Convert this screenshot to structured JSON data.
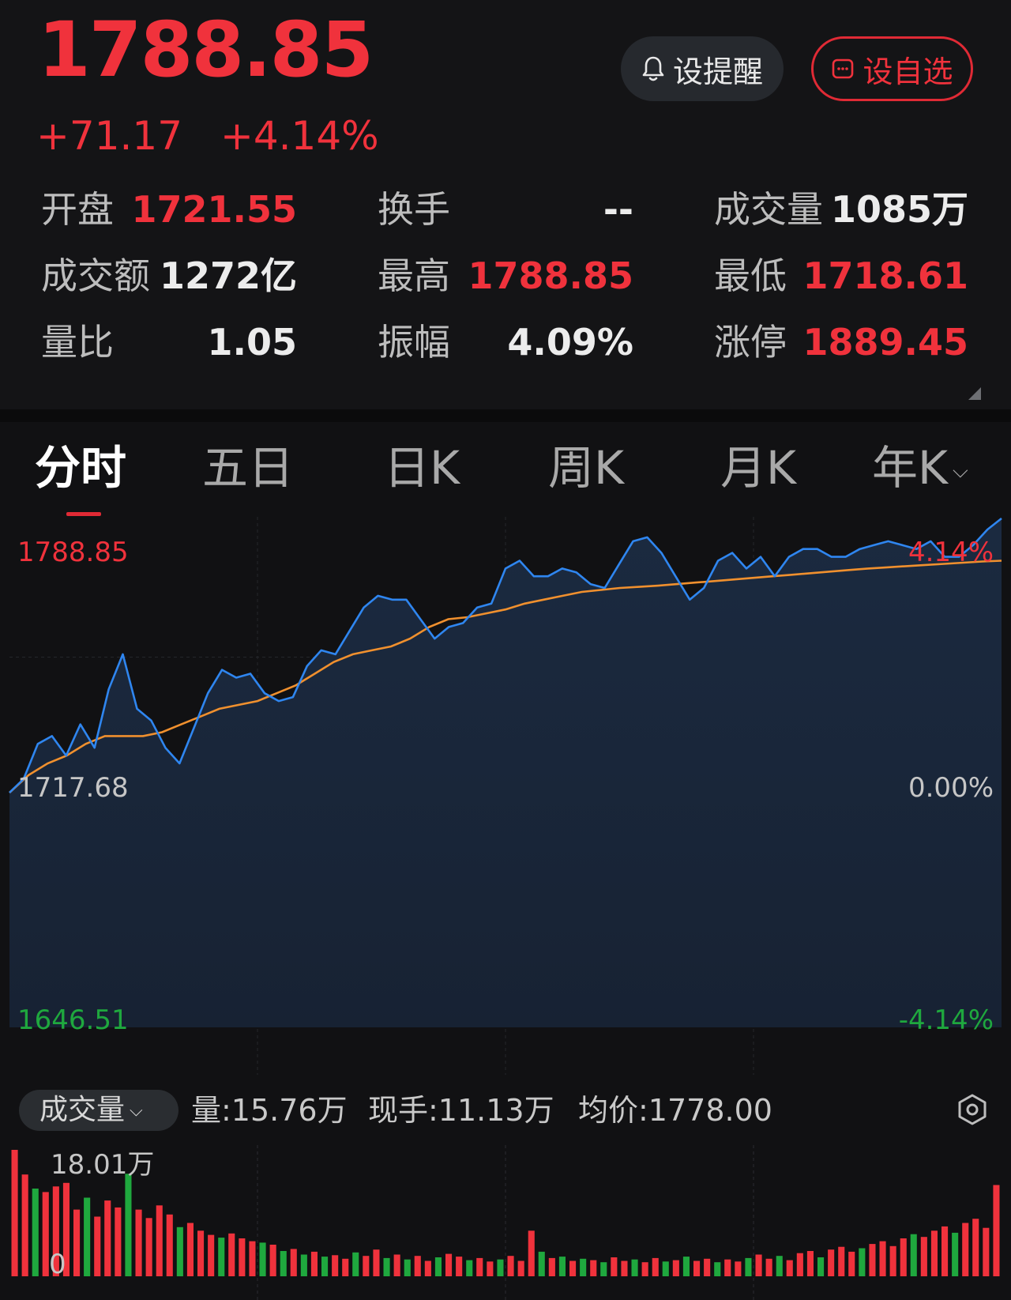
{
  "quote": {
    "price": "1788.85",
    "change": "+71.17",
    "change_pct": "+4.14%"
  },
  "buttons": {
    "alert_label": "设提醒",
    "watchlist_label": "设自选"
  },
  "stats": [
    {
      "label": "开盘",
      "value": "1721.55",
      "color": "red"
    },
    {
      "label": "换手",
      "value": "--",
      "color": "white"
    },
    {
      "label": "成交量",
      "value": "1085万",
      "color": "white"
    },
    {
      "label": "成交额",
      "value": "1272亿",
      "color": "white"
    },
    {
      "label": "最高",
      "value": "1788.85",
      "color": "red"
    },
    {
      "label": "最低",
      "value": "1718.61",
      "color": "red"
    },
    {
      "label": "量比",
      "value": "1.05",
      "color": "white"
    },
    {
      "label": "振幅",
      "value": "4.09%",
      "color": "white"
    },
    {
      "label": "涨停",
      "value": "1889.45",
      "color": "red"
    }
  ],
  "tabs": [
    "分时",
    "五日",
    "日K",
    "周K",
    "月K",
    "年K"
  ],
  "active_tab": "分时",
  "volume_bar": {
    "selector": "成交量",
    "vol_label": "量:15.76万",
    "now_label": "现手:11.13万",
    "avg_label": "均价:1778.00"
  },
  "colors": {
    "up": "#f0323c",
    "down": "#1fa83e",
    "price_line": "#2f86f0",
    "avg_line": "#f0902e",
    "background": "#111113"
  },
  "chart_data": {
    "type": "line",
    "title": "",
    "prev_close": 1717.68,
    "ylim": [
      1646.51,
      1788.85
    ],
    "y_labels_left": [
      "1788.85",
      "1717.68",
      "1646.51"
    ],
    "y_labels_right": [
      "4.14%",
      "0.00%",
      "-4.14%"
    ],
    "series": [
      {
        "values": [
          1718.5,
          1722,
          1731,
          1733,
          1728,
          1736,
          1730,
          1745,
          1754,
          1740,
          1737,
          1730,
          1726,
          1735,
          1744,
          1750,
          1748,
          1749,
          1744,
          1742,
          1743,
          1751,
          1755,
          1754,
          1760,
          1766,
          1769,
          1768,
          1768,
          1763,
          1758,
          1761,
          1762,
          1766,
          1767,
          1776,
          1778,
          1774,
          1774,
          1776,
          1775,
          1772,
          1771,
          1777,
          1783,
          1784,
          1780,
          1774,
          1768,
          1771,
          1778,
          1780,
          1776,
          1779,
          1774,
          1779,
          1781,
          1781,
          1779,
          1779,
          1781,
          1782,
          1783,
          1782,
          1781,
          1783,
          1779,
          1779,
          1782,
          1786,
          1788.85
        ]
      },
      {
        "values": [
          1718.5,
          1723,
          1726,
          1728,
          1731,
          1733,
          1733,
          1733,
          1734,
          1736,
          1738,
          1740,
          1741,
          1742,
          1744,
          1746,
          1749,
          1752,
          1754,
          1755,
          1756,
          1758,
          1761,
          1763,
          1763.5,
          1764.5,
          1765.5,
          1767,
          1768,
          1769,
          1770,
          1770.5,
          1771,
          1771.3,
          1771.6,
          1772,
          1772.4,
          1772.8,
          1773.2,
          1773.6,
          1774,
          1774.4,
          1774.8,
          1775.2,
          1775.6,
          1776,
          1776.3,
          1776.6,
          1776.9,
          1777.2,
          1777.5,
          1777.8,
          1778
        ]
      }
    ],
    "volume": {
      "max_label": "18.01万",
      "min_label": "0",
      "max": 18.01,
      "bars": [
        {
          "v": 18.01,
          "c": "up"
        },
        {
          "v": 14.5,
          "c": "up"
        },
        {
          "v": 12.5,
          "c": "down"
        },
        {
          "v": 12.0,
          "c": "up"
        },
        {
          "v": 12.8,
          "c": "up"
        },
        {
          "v": 13.3,
          "c": "up"
        },
        {
          "v": 9.5,
          "c": "up"
        },
        {
          "v": 11.2,
          "c": "down"
        },
        {
          "v": 8.5,
          "c": "up"
        },
        {
          "v": 10.8,
          "c": "up"
        },
        {
          "v": 9.8,
          "c": "up"
        },
        {
          "v": 14.6,
          "c": "down"
        },
        {
          "v": 9.5,
          "c": "up"
        },
        {
          "v": 8.3,
          "c": "up"
        },
        {
          "v": 10.1,
          "c": "up"
        },
        {
          "v": 8.8,
          "c": "up"
        },
        {
          "v": 7.0,
          "c": "down"
        },
        {
          "v": 7.6,
          "c": "up"
        },
        {
          "v": 6.5,
          "c": "up"
        },
        {
          "v": 5.9,
          "c": "up"
        },
        {
          "v": 5.5,
          "c": "down"
        },
        {
          "v": 6.1,
          "c": "up"
        },
        {
          "v": 5.4,
          "c": "up"
        },
        {
          "v": 5.0,
          "c": "up"
        },
        {
          "v": 4.8,
          "c": "down"
        },
        {
          "v": 4.5,
          "c": "up"
        },
        {
          "v": 3.6,
          "c": "down"
        },
        {
          "v": 3.9,
          "c": "up"
        },
        {
          "v": 3.1,
          "c": "down"
        },
        {
          "v": 3.5,
          "c": "up"
        },
        {
          "v": 2.8,
          "c": "down"
        },
        {
          "v": 3.0,
          "c": "up"
        },
        {
          "v": 2.5,
          "c": "up"
        },
        {
          "v": 3.4,
          "c": "down"
        },
        {
          "v": 2.9,
          "c": "up"
        },
        {
          "v": 3.8,
          "c": "up"
        },
        {
          "v": 2.6,
          "c": "down"
        },
        {
          "v": 3.1,
          "c": "up"
        },
        {
          "v": 2.4,
          "c": "down"
        },
        {
          "v": 2.9,
          "c": "up"
        },
        {
          "v": 2.2,
          "c": "up"
        },
        {
          "v": 2.7,
          "c": "down"
        },
        {
          "v": 3.2,
          "c": "up"
        },
        {
          "v": 2.8,
          "c": "up"
        },
        {
          "v": 2.3,
          "c": "down"
        },
        {
          "v": 2.6,
          "c": "up"
        },
        {
          "v": 2.1,
          "c": "up"
        },
        {
          "v": 2.4,
          "c": "down"
        },
        {
          "v": 2.9,
          "c": "up"
        },
        {
          "v": 2.2,
          "c": "up"
        },
        {
          "v": 6.5,
          "c": "up"
        },
        {
          "v": 3.5,
          "c": "down"
        },
        {
          "v": 2.6,
          "c": "up"
        },
        {
          "v": 2.8,
          "c": "down"
        },
        {
          "v": 2.2,
          "c": "up"
        },
        {
          "v": 2.5,
          "c": "down"
        },
        {
          "v": 2.3,
          "c": "up"
        },
        {
          "v": 2.0,
          "c": "down"
        },
        {
          "v": 2.7,
          "c": "up"
        },
        {
          "v": 2.2,
          "c": "up"
        },
        {
          "v": 2.4,
          "c": "down"
        },
        {
          "v": 2.0,
          "c": "up"
        },
        {
          "v": 2.6,
          "c": "up"
        },
        {
          "v": 2.1,
          "c": "down"
        },
        {
          "v": 2.3,
          "c": "up"
        },
        {
          "v": 2.8,
          "c": "down"
        },
        {
          "v": 2.2,
          "c": "up"
        },
        {
          "v": 2.5,
          "c": "up"
        },
        {
          "v": 2.0,
          "c": "down"
        },
        {
          "v": 2.4,
          "c": "up"
        },
        {
          "v": 2.1,
          "c": "up"
        },
        {
          "v": 2.6,
          "c": "down"
        },
        {
          "v": 3.1,
          "c": "up"
        },
        {
          "v": 2.5,
          "c": "up"
        },
        {
          "v": 2.9,
          "c": "down"
        },
        {
          "v": 2.3,
          "c": "up"
        },
        {
          "v": 3.3,
          "c": "up"
        },
        {
          "v": 3.6,
          "c": "up"
        },
        {
          "v": 2.7,
          "c": "down"
        },
        {
          "v": 3.8,
          "c": "up"
        },
        {
          "v": 4.2,
          "c": "up"
        },
        {
          "v": 3.5,
          "c": "up"
        },
        {
          "v": 4.0,
          "c": "down"
        },
        {
          "v": 4.6,
          "c": "up"
        },
        {
          "v": 5.0,
          "c": "up"
        },
        {
          "v": 4.3,
          "c": "up"
        },
        {
          "v": 5.4,
          "c": "up"
        },
        {
          "v": 6.0,
          "c": "down"
        },
        {
          "v": 5.6,
          "c": "up"
        },
        {
          "v": 6.5,
          "c": "up"
        },
        {
          "v": 7.1,
          "c": "up"
        },
        {
          "v": 6.2,
          "c": "down"
        },
        {
          "v": 7.6,
          "c": "up"
        },
        {
          "v": 8.2,
          "c": "up"
        },
        {
          "v": 6.9,
          "c": "up"
        },
        {
          "v": 13.0,
          "c": "up"
        }
      ]
    }
  }
}
